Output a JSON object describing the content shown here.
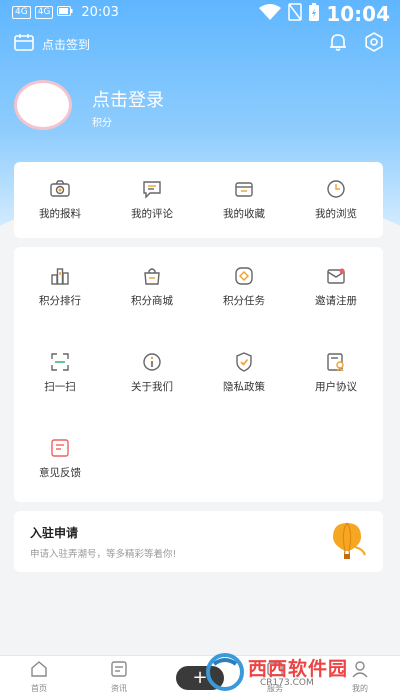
{
  "statusbar": {
    "time_left": "20:03",
    "clock": "10:04",
    "sig1": "4G",
    "sig2": "4G"
  },
  "header": {
    "checkin_label": "点击签到",
    "login_title": "点击登录",
    "points_label": "积分"
  },
  "quick": {
    "items": [
      {
        "label": "我的报料",
        "icon": "camera-icon"
      },
      {
        "label": "我的评论",
        "icon": "comment-icon"
      },
      {
        "label": "我的收藏",
        "icon": "folder-icon"
      },
      {
        "label": "我的浏览",
        "icon": "clock-icon"
      }
    ]
  },
  "services": {
    "items": [
      {
        "label": "积分排行",
        "icon": "ranking-icon"
      },
      {
        "label": "积分商城",
        "icon": "shopping-bag-icon"
      },
      {
        "label": "积分任务",
        "icon": "task-icon"
      },
      {
        "label": "邀请注册",
        "icon": "mail-icon"
      },
      {
        "label": "扫一扫",
        "icon": "scan-icon"
      },
      {
        "label": "关于我们",
        "icon": "info-icon"
      },
      {
        "label": "隐私政策",
        "icon": "shield-icon"
      },
      {
        "label": "用户协议",
        "icon": "user-agreement-icon"
      },
      {
        "label": "意见反馈",
        "icon": "feedback-icon"
      }
    ]
  },
  "join": {
    "title": "入驻申请",
    "desc": "申请入驻弄潮号，等多精彩等着你!",
    "icon": "hot-air-balloon-icon"
  },
  "tabbar": {
    "tabs": [
      {
        "label": "首页",
        "icon": "home-icon"
      },
      {
        "label": "资讯",
        "icon": "news-icon"
      },
      {
        "label": "服务",
        "icon": "service-icon"
      },
      {
        "label": "我的",
        "icon": "profile-icon"
      }
    ],
    "plus": "+"
  },
  "watermark": {
    "text": "西西软件园",
    "sub": "CR173.COM"
  },
  "colors": {
    "hero_top": "#5fb6ff",
    "accent_orange": "#f0a030",
    "watermark_red": "#e44444"
  }
}
